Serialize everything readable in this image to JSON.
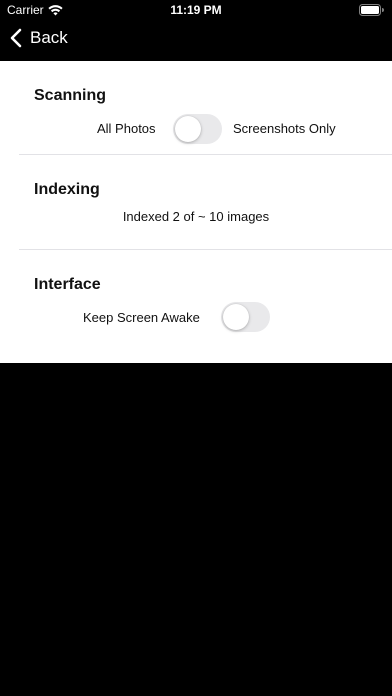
{
  "status_bar": {
    "carrier": "Carrier",
    "time": "11:19 PM",
    "icons": [
      "wifi-icon",
      "battery-icon"
    ]
  },
  "nav": {
    "back_label": "Back",
    "back_icon": "chevron-left-icon"
  },
  "sections": {
    "scanning": {
      "title": "Scanning",
      "left_label": "All Photos",
      "right_label": "Screenshots Only",
      "toggle_on": false
    },
    "indexing": {
      "title": "Indexing",
      "status": "Indexed 2 of ~ 10 images"
    },
    "interface": {
      "title": "Interface",
      "label": "Keep Screen Awake",
      "toggle_on": false
    }
  },
  "colors": {
    "background": "#000000",
    "panel": "#ffffff",
    "toggle_off_track": "#e9e9eb",
    "divider": "#e2e2e6"
  }
}
